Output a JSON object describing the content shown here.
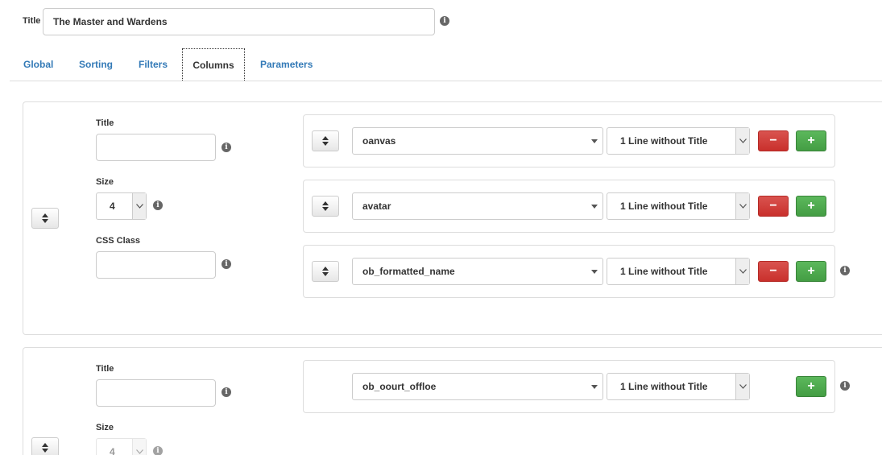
{
  "header": {
    "title_label": "Title",
    "title_value": "The Master and Wardens"
  },
  "tabs": [
    {
      "label": "Global",
      "active": false
    },
    {
      "label": "Sorting",
      "active": false
    },
    {
      "label": "Filters",
      "active": false
    },
    {
      "label": "Columns",
      "active": true
    },
    {
      "label": "Parameters",
      "active": false
    }
  ],
  "column_groups": [
    {
      "title_label": "Title",
      "title_value": "",
      "size_label": "Size",
      "size_value": "4",
      "css_label": "CSS Class",
      "css_value": "",
      "fields": [
        {
          "name": "oanvas",
          "format": "1 Line without Title",
          "remove": "−",
          "add": "+"
        },
        {
          "name": "avatar",
          "format": "1 Line without Title",
          "remove": "−",
          "add": "+"
        },
        {
          "name": "ob_formatted_name",
          "format": "1 Line without Title",
          "remove": "−",
          "add": "+"
        }
      ]
    },
    {
      "title_label": "Title",
      "title_value": "",
      "size_label": "Size",
      "size_value": "4",
      "fields": [
        {
          "name": "ob_oourt_offloe",
          "format": "1 Line without Title",
          "add": "+"
        }
      ]
    }
  ],
  "icons": {
    "info": "info-icon",
    "sort": "sort-icon"
  }
}
